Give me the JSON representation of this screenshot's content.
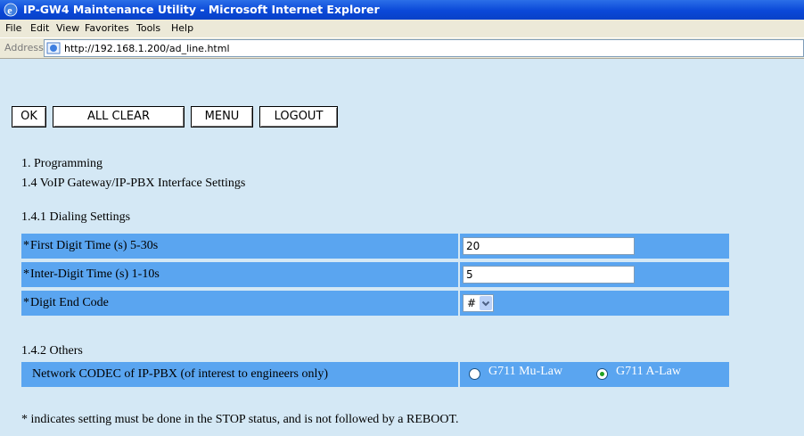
{
  "window": {
    "title": "IP-GW4 Maintenance Utility - Microsoft Internet Explorer"
  },
  "menu": [
    "File",
    "Edit",
    "View",
    "Favorites",
    "Tools",
    "Help"
  ],
  "address": {
    "label": "Address",
    "url": "http://192.168.1.200/ad_line.html"
  },
  "toolbar": {
    "ok": "OK",
    "all_clear": "ALL CLEAR",
    "menu": "MENU",
    "logout": "LOGOUT"
  },
  "heading": {
    "line1": "1. Programming",
    "line2": "1.4 VoIP Gateway/IP-PBX Interface Settings"
  },
  "dialing": {
    "title": "1.4.1 Dialing Settings",
    "rows": [
      {
        "marker": "*",
        "label": "First Digit Time (s) 5-30s",
        "value": "20"
      },
      {
        "marker": "*",
        "label": "Inter-Digit Time (s) 1-10s",
        "value": "5"
      },
      {
        "marker": "*",
        "label": "Digit End Code",
        "value": "#"
      }
    ]
  },
  "others": {
    "title": "1.4.2 Others",
    "row": {
      "label": "Network CODEC of IP-PBX (of interest to engineers only)",
      "options": [
        "G711 Mu-Law",
        "G711 A-Law"
      ],
      "selected": "G711 A-Law"
    }
  },
  "footnote": "* indicates setting must be done in the STOP status, and is not followed by a REBOOT.",
  "colors": {
    "page_bg": "#d4e8f5",
    "row_bg": "#5aa5f0",
    "title_bar": "#0a48d8",
    "radio_dot": "#21a121"
  },
  "icons": [
    "ie-logo-icon",
    "page-icon",
    "dropdown-arrow-icon",
    "radio-icon"
  ]
}
